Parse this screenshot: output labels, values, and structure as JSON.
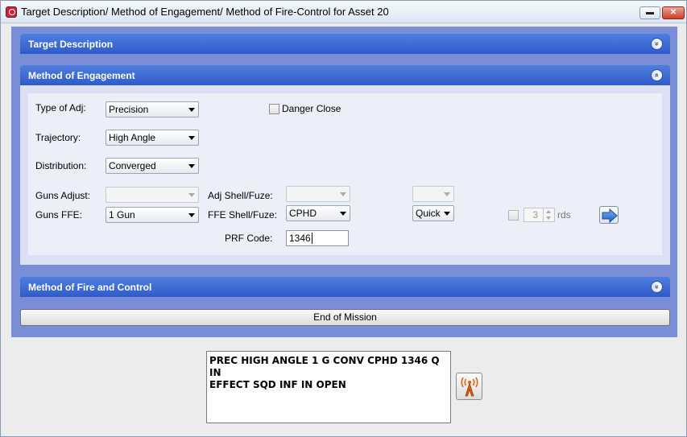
{
  "window": {
    "title": "Target Description/ Method of Engagement/ Method of Fire-Control for Asset 20",
    "minimize_glyph": "▬",
    "close_glyph": "✕"
  },
  "sections": {
    "target_description": {
      "title": "Target Description",
      "state": "collapsed",
      "chevron": "»"
    },
    "method_of_engagement": {
      "title": "Method of Engagement",
      "state": "expanded",
      "chevron": "«"
    },
    "method_of_fire": {
      "title": "Method of Fire and Control",
      "state": "collapsed",
      "chevron": "»"
    }
  },
  "engagement": {
    "type_of_adj": {
      "label": "Type of Adj:",
      "value": "Precision"
    },
    "danger_close": {
      "label": "Danger Close",
      "checked": false
    },
    "trajectory": {
      "label": "Trajectory:",
      "value": "High Angle"
    },
    "distribution": {
      "label": "Distribution:",
      "value": "Converged"
    },
    "guns_adjust": {
      "label": "Guns Adjust:",
      "value": "",
      "enabled": false
    },
    "adj_shell_fuze": {
      "label": "Adj Shell/Fuze:",
      "shell": "",
      "fuze": "",
      "enabled": false
    },
    "guns_ffe": {
      "label": "Guns FFE:",
      "value": "1 Gun"
    },
    "ffe_shell_fuze": {
      "label": "FFE Shell/Fuze:",
      "shell": "CPHD",
      "fuze": "Quick"
    },
    "rounds": {
      "checked": false,
      "value": "3",
      "unit": "rds",
      "enabled": false
    },
    "prf_code": {
      "label": "PRF Code:",
      "value": "1346"
    }
  },
  "end_of_mission": {
    "label": "End of Mission"
  },
  "message": {
    "line1": "PREC HIGH ANGLE 1 G CONV CPHD 1346 Q IN",
    "line2": "EFFECT SQD INF IN OPEN"
  },
  "colors": {
    "section_header": "#3a66d2",
    "panel_background": "#7a8ed8",
    "content_background": "#eceff8"
  }
}
